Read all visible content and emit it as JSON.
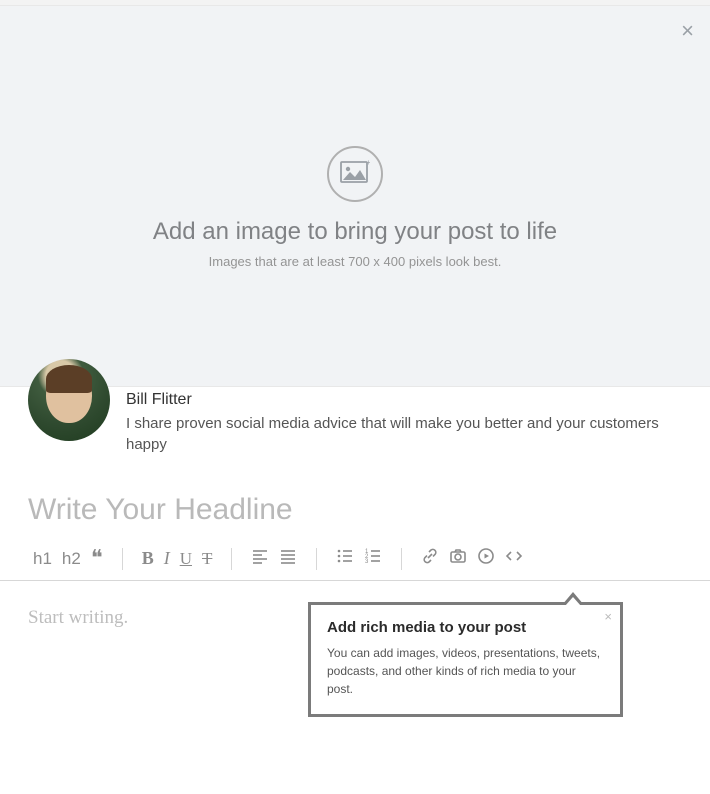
{
  "colors": {
    "placeholder": "#b9b9b9",
    "muted": "#8b8b8b",
    "border": "#7b7b7b"
  },
  "hero": {
    "title": "Add an image to bring your post to life",
    "subtitle": "Images that are at least 700 x 400 pixels look best."
  },
  "author": {
    "name": "Bill Flitter",
    "bio": "I share proven social media advice that will make you better and your customers happy"
  },
  "headline": {
    "placeholder": "Write Your Headline",
    "value": ""
  },
  "toolbar": {
    "h1": "h1",
    "h2": "h2",
    "bold": "B",
    "italic": "I",
    "underline": "U",
    "strike": "T"
  },
  "body": {
    "placeholder": "Start writing.",
    "value": ""
  },
  "popover": {
    "title": "Add rich media to your post",
    "body": "You can add images, videos, presentations, tweets, podcasts, and other kinds of rich media to your post."
  }
}
